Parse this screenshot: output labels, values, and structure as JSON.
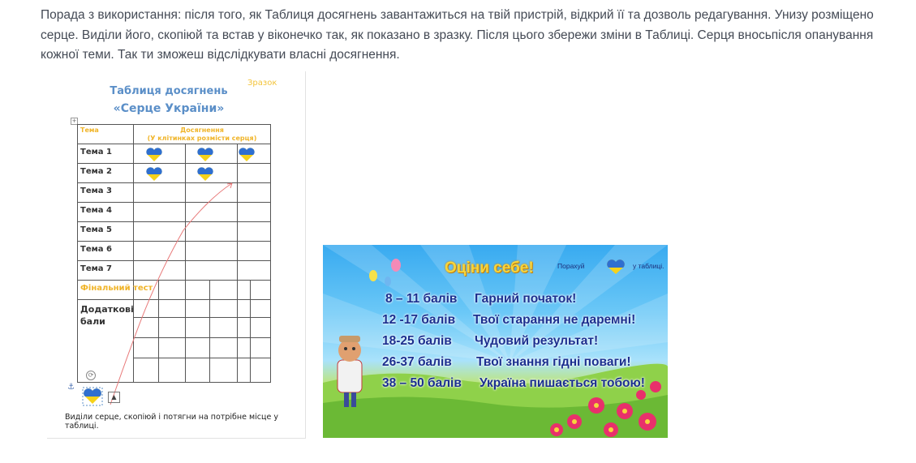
{
  "intro_text": "Порада з використання: після того, як Таблиця досягнень завантажиться на твій пристрій, відкрий її та дозволь редагування. Унизу розміщено серце. Виділи його, скопіюй та встав у віконечко так, як показано в зразку. Після цього збережи зміни в Таблиці. Серця вносьпісля опанування кожної теми. Так ти зможеш відслідкувати власні досягнення.",
  "sample": {
    "zrazok": "Зразок",
    "title_line1": "Таблиця досягнень",
    "title_line2": "«Серце України»",
    "col_tema": "Тема",
    "col_dosyagnennya": "Досягнення",
    "col_note": "(У клітинках розмісти серця)",
    "rows": [
      "Тема 1",
      "Тема 2",
      "Тема 3",
      "Тема 4",
      "Тема 5",
      "Тема 6",
      "Тема 7"
    ],
    "final_test": "Фінальний тест",
    "dodatkovi": [
      "Додаткові",
      "бали"
    ],
    "caption": "Виділи серце, скопіюй і потягни на потрібне місце у таблиці.",
    "heart_colors": {
      "top": "#2f6fd0",
      "bottom": "#f6d21a"
    }
  },
  "poster": {
    "title": "Оціни себе!",
    "count_prefix": "Порахуй",
    "count_suffix": "у таблиці.",
    "rows": [
      {
        "range": "8 – 11 балів",
        "msg": "Гарний початок!"
      },
      {
        "range": "12 -17 балів",
        "msg": "Твої старання не даремні!"
      },
      {
        "range": "18-25 балів",
        "msg": "Чудовий результат!"
      },
      {
        "range": "26-37 балів",
        "msg": "Твої знання гідні поваги!"
      },
      {
        "range": "38 – 50 балів",
        "msg": "Україна пишається тобою!"
      }
    ],
    "colors": {
      "title": "#f7d53c",
      "text": "#1b2f8f",
      "flower": "#e8306b"
    }
  }
}
